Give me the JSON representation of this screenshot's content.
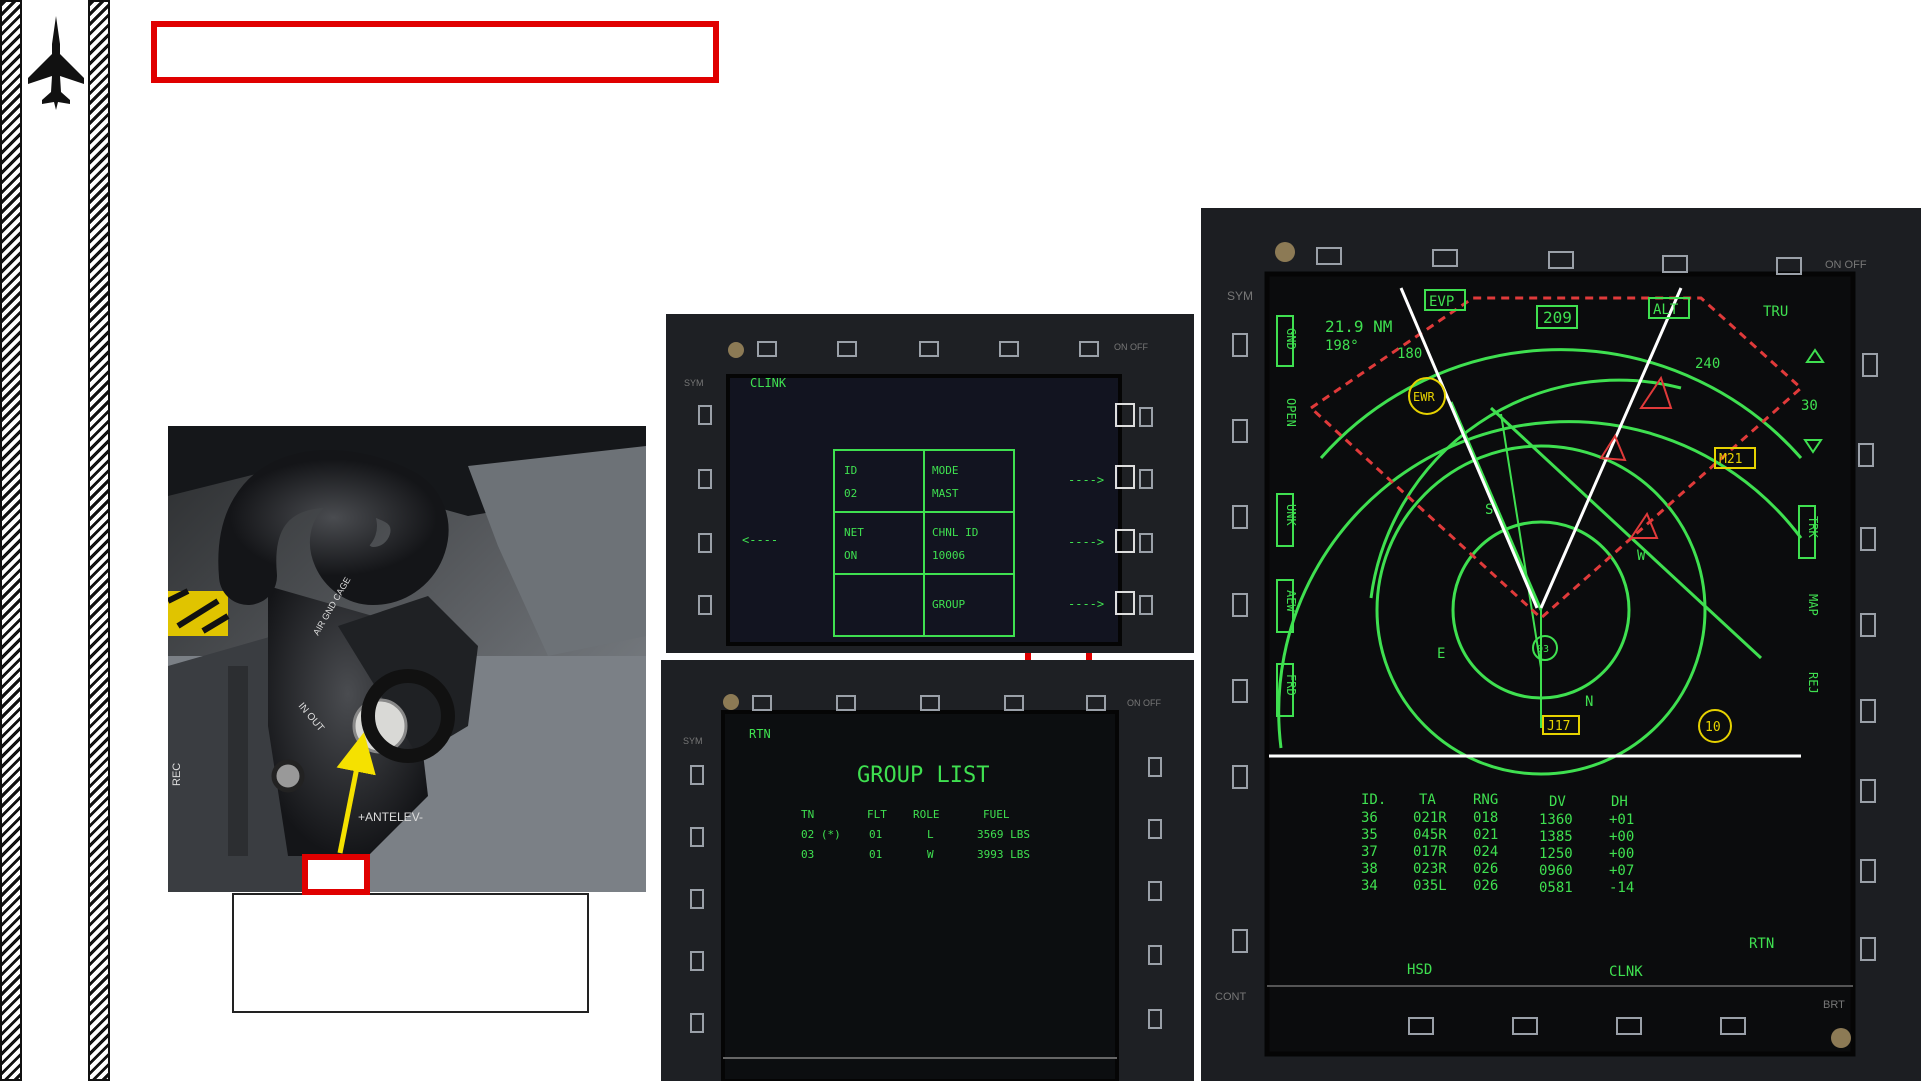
{
  "colors": {
    "accent_red": "#e00000",
    "callout_yellow": "#f5e100",
    "mfd_green": "#3fe050",
    "radar_red": "#e03a3a"
  },
  "sidebar": {
    "icon": "fighter-jet-icon"
  },
  "photo": {
    "labels": {
      "rec": "REC",
      "in_out": "IN OUT",
      "antelev": "+ANTELEV-",
      "mode_ring": "AIR GND CAGE"
    }
  },
  "clink_page": {
    "page_label": "CLINK",
    "on_off": "ON\nOFF",
    "sym": "SYM",
    "grid": [
      {
        "title": "ID",
        "value": "02"
      },
      {
        "title": "MODE",
        "value": "MAST"
      },
      {
        "title": "NET",
        "value": "ON"
      },
      {
        "title": "CHNL ID",
        "value": "10006"
      },
      {
        "title": "",
        "value": ""
      },
      {
        "title": "GROUP",
        "value": ""
      }
    ],
    "left_arrow": "<----",
    "right_arrow": "---->"
  },
  "group_list_page": {
    "rtn": "RTN",
    "sym": "SYM",
    "on_off": "ON\nOFF",
    "title": "GROUP LIST",
    "columns": [
      "TN",
      "FLT",
      "ROLE",
      "FUEL"
    ],
    "rows": [
      {
        "tn": "02 (*)",
        "flt": "01",
        "role": "L",
        "fuel": "3569 LBS"
      },
      {
        "tn": "03",
        "flt": "01",
        "role": "W",
        "fuel": "3993 LBS"
      }
    ]
  },
  "hsd_page": {
    "sym": "SYM",
    "on_off": "ON\nOFF",
    "range_nm": "21.9 NM",
    "bearing": "198°",
    "heading_box": "209",
    "scale_labels": [
      "180",
      "240"
    ],
    "tru": "TRU",
    "scale_number": "30",
    "left_buttons": [
      "GND",
      "OPEN",
      "UNK",
      "AEW",
      "FRD"
    ],
    "right_buttons": [
      "TRK",
      "MAP",
      "REJ"
    ],
    "top_boxes": [
      "EVP",
      "ALT"
    ],
    "threats": [
      "EWR",
      "M21"
    ],
    "letters": [
      "S",
      "W",
      "E",
      "N"
    ],
    "own_marker": "J17",
    "track_tag": "03",
    "speed_circle": "10",
    "table": {
      "headers": [
        "ID.",
        "TA",
        "RNG",
        "DV",
        "DH"
      ],
      "rows": [
        [
          "36",
          "021R",
          "018",
          "1360",
          "+01"
        ],
        [
          "35",
          "045R",
          "021",
          "1385",
          "+00"
        ],
        [
          "37",
          "017R",
          "024",
          "1250",
          "+00"
        ],
        [
          "38",
          "023R",
          "026",
          "0960",
          "+07"
        ],
        [
          "34",
          "035L",
          "026",
          "0581",
          "-14"
        ]
      ]
    },
    "bottom_labels": {
      "hsd": "HSD",
      "clnk": "CLNK",
      "rtn": "RTN",
      "cont": "CONT",
      "brt": "BRT"
    }
  }
}
